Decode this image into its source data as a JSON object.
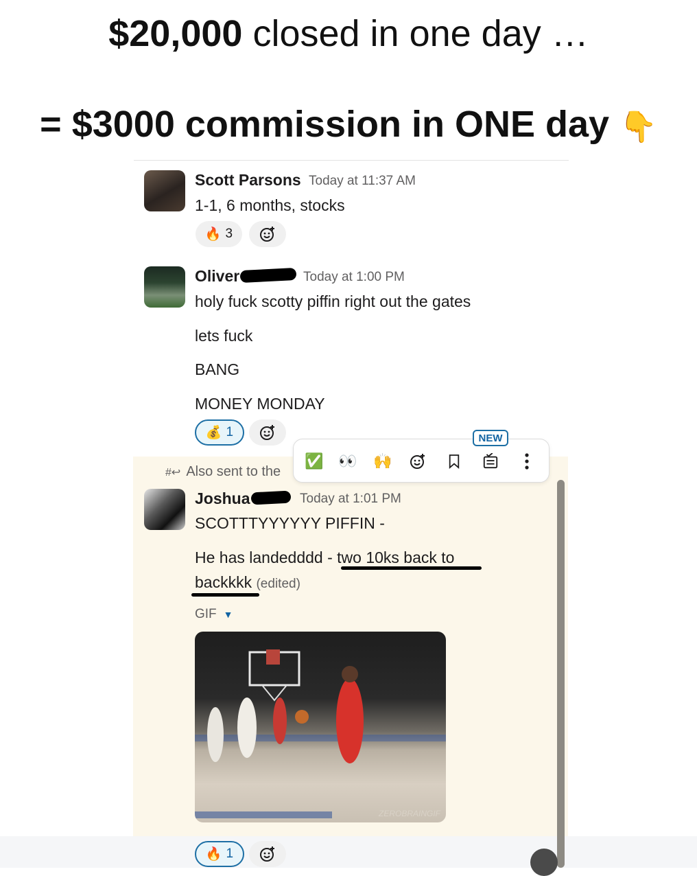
{
  "headline": {
    "line1_bold": "$20,000",
    "line1_rest": " closed in one day …",
    "line2": "= $3000 commission in ONE day",
    "line2_emoji": "👇"
  },
  "messages": [
    {
      "author": "Scott Parsons",
      "time": "Today at 11:37 AM",
      "lines": [
        "1-1, 6 months, stocks"
      ],
      "reactions": [
        {
          "emoji": "🔥",
          "count": "3"
        }
      ]
    },
    {
      "author": "Oliver",
      "time": "Today at 1:00 PM",
      "lines": [
        "holy fuck scotty piffin right out the gates",
        "lets fuck",
        "BANG",
        "MONEY MONDAY"
      ],
      "reactions": [
        {
          "emoji": "💰",
          "count": "1"
        }
      ]
    },
    {
      "author": "Joshua",
      "time": "Today at 1:01 PM",
      "lines": [
        "SCOTTTYYYYYY PIFFIN -",
        "He has landedddd - two 10ks back to",
        "backkkk"
      ],
      "edited": "(edited)",
      "gif_label": "GIF",
      "gif_watermark": "ZEROBRAINGIF",
      "reactions": [
        {
          "emoji": "🔥",
          "count": "1"
        }
      ]
    }
  ],
  "also_sent": {
    "icon": "#↩",
    "text": "Also sent to the"
  },
  "toolbar": {
    "new_badge": "NEW",
    "items": [
      "✅",
      "👀",
      "🙌",
      "add-reaction-icon",
      "bookmark-icon",
      "reminder-list-icon",
      "more-icon"
    ]
  },
  "colors": {
    "link_blue": "#1264a3",
    "highlight_bg": "#fcf7ea",
    "muted_text": "#616061"
  }
}
